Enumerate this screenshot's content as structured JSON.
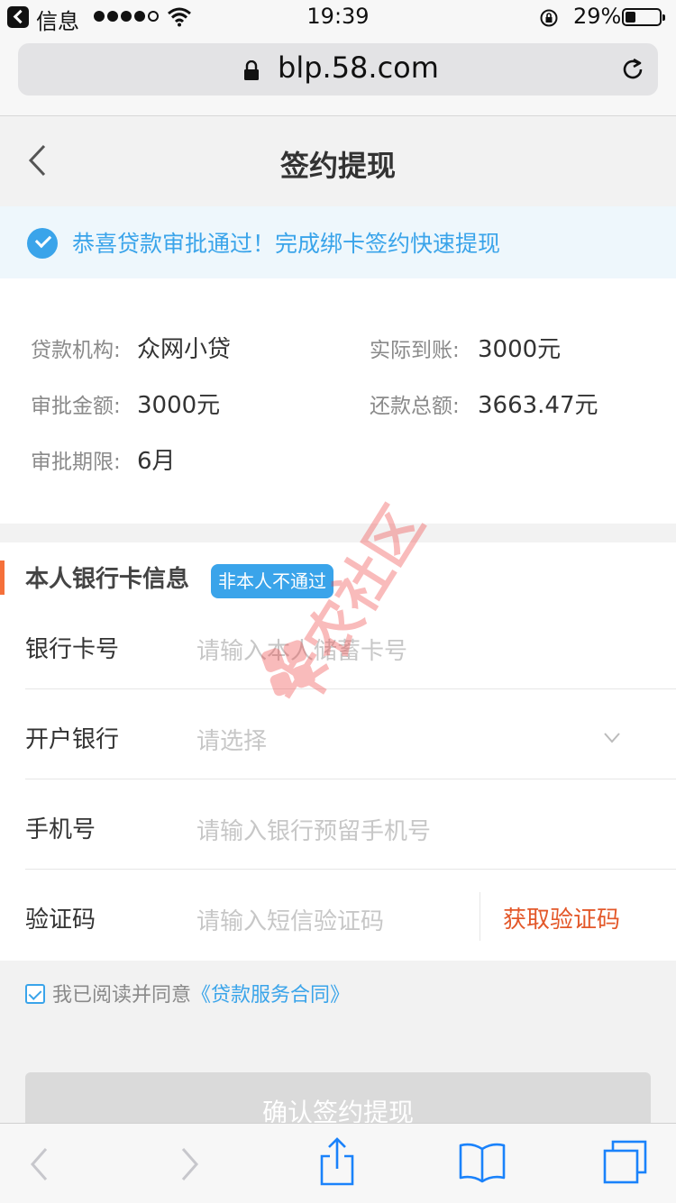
{
  "status_bar": {
    "back_app": "信息",
    "time": "19:39",
    "battery": "29%"
  },
  "browser": {
    "url": "blp.58.com"
  },
  "nav": {
    "title": "签约提现"
  },
  "notice": {
    "message": "恭喜贷款审批通过！完成绑卡签约快速提现"
  },
  "loan_info": {
    "institution_label": "贷款机构:",
    "institution_value": "众网小贷",
    "received_label": "实际到账:",
    "received_value": "3000元",
    "amount_label": "审批金额:",
    "amount_value": "3000元",
    "total_label": "还款总额:",
    "total_value": "3663.47元",
    "term_label": "审批期限:",
    "term_value": "6月"
  },
  "bank_section": {
    "title": "本人银行卡信息",
    "badge": "非本人不通过",
    "card_label": "银行卡号",
    "card_placeholder": "请输入本人储蓄卡号",
    "bank_label": "开户银行",
    "bank_placeholder": "请选择",
    "phone_label": "手机号",
    "phone_placeholder": "请输入银行预留手机号",
    "code_label": "验证码",
    "code_placeholder": "请输入短信验证码",
    "get_code": "获取验证码"
  },
  "agreement": {
    "prefix": "我已阅读并同意",
    "link": "《贷款服务合同》",
    "checked": true
  },
  "confirm_button": "确认签约提现",
  "watermark": "卡农社区",
  "colors": {
    "accent_blue": "#3aa4ea",
    "accent_orange": "#e3582a",
    "bar_orange": "#f5703a"
  }
}
